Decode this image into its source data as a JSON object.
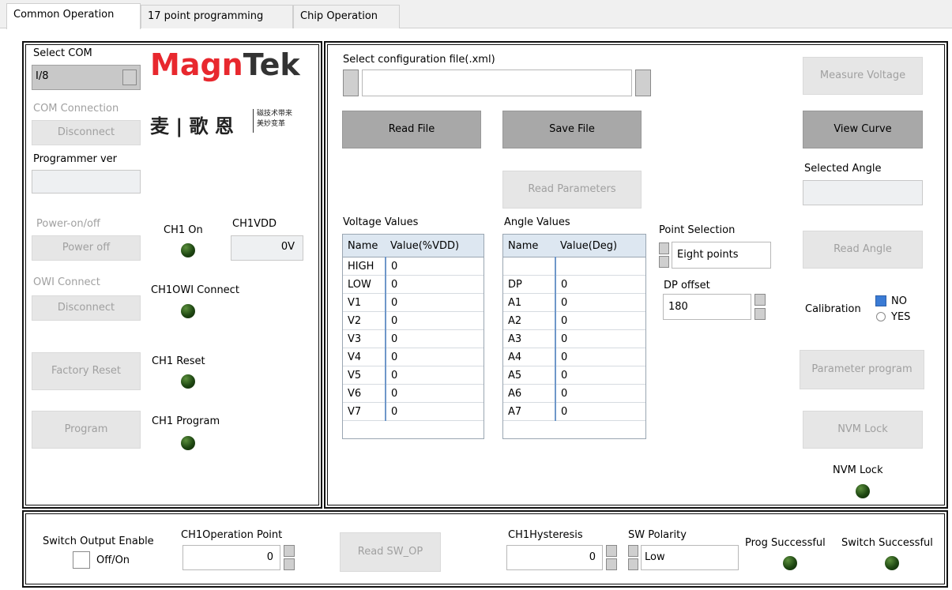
{
  "tabs": [
    "Common Operation",
    "17 point programming",
    "Chip Operation"
  ],
  "left": {
    "select_com_label": "Select COM",
    "com_value": "I/8",
    "logo_text_1": "Mag",
    "logo_text_2": "n",
    "logo_text_3": "Tek",
    "logo_cn": "麦 | 歌  恩",
    "logo_slogan_1": "磁技术带来",
    "logo_slogan_2": "美妙变革",
    "com_connection_label": "COM Connection",
    "com_connection_btn": "Disconnect",
    "programmer_ver_label": "Programmer ver",
    "programmer_ver_value": "",
    "power_label": "Power-on/off",
    "power_btn": "Power off",
    "ch1_on_label": "CH1 On",
    "ch1vdd_label": "CH1VDD",
    "ch1vdd_value": "0V",
    "owi_label": "OWI Connect",
    "owi_btn": "Disconnect",
    "ch1owi_label": "CH1OWI Connect",
    "factory_reset_btn": "Factory Reset",
    "ch1_reset_label": "CH1 Reset",
    "program_btn": "Program",
    "ch1_program_label": "CH1 Program"
  },
  "main": {
    "select_config_label": "Select configuration file(.xml)",
    "config_path": "",
    "read_file_btn": "Read File",
    "save_file_btn": "Save File",
    "read_params_btn": "Read Parameters",
    "voltage_title": "Voltage Values",
    "voltage_headers": [
      "Name",
      "Value(%VDD)"
    ],
    "voltage_rows": [
      [
        "HIGH",
        "0"
      ],
      [
        "LOW",
        "0"
      ],
      [
        "V1",
        "0"
      ],
      [
        "V2",
        "0"
      ],
      [
        "V3",
        "0"
      ],
      [
        "V4",
        "0"
      ],
      [
        "V5",
        "0"
      ],
      [
        "V6",
        "0"
      ],
      [
        "V7",
        "0"
      ]
    ],
    "angle_title": "Angle Values",
    "angle_headers": [
      "Name",
      "Value(Deg)"
    ],
    "angle_rows": [
      [
        "",
        ""
      ],
      [
        "DP",
        "0"
      ],
      [
        "A1",
        "0"
      ],
      [
        "A2",
        "0"
      ],
      [
        "A3",
        "0"
      ],
      [
        "A4",
        "0"
      ],
      [
        "A5",
        "0"
      ],
      [
        "A6",
        "0"
      ],
      [
        "A7",
        "0"
      ]
    ],
    "point_selection_label": "Point Selection",
    "point_selection_value": "Eight points",
    "dp_offset_label": "DP offset",
    "dp_offset_value": "180",
    "measure_voltage_btn": "Measure  Voltage",
    "view_curve_btn": "View Curve",
    "selected_angle_label": "Selected Angle",
    "selected_angle_value": "",
    "read_angle_btn": "Read  Angle",
    "calibration_label": "Calibration",
    "cal_no": "NO",
    "cal_yes": "YES",
    "param_program_btn": "Parameter program",
    "nvm_lock_btn": "NVM Lock",
    "nvm_lock_label": "NVM Lock"
  },
  "bottom": {
    "switch_enable_label": "Switch Output Enable",
    "off_on_label": "Off/On",
    "op_point_label": "CH1Operation Point",
    "op_point_value": "0",
    "read_sw_op_btn": "Read SW_OP",
    "hysteresis_label": "CH1Hysteresis",
    "hysteresis_value": "0",
    "sw_polarity_label": "SW Polarity",
    "sw_polarity_value": "Low",
    "prog_success_label": "Prog Successful",
    "switch_success_label": "Switch Successful"
  },
  "colors": {
    "logo_red": "#e8282e",
    "logo_dark": "#333333",
    "led_green": "#1e4712",
    "accent_blue": "#3a7bd5"
  }
}
